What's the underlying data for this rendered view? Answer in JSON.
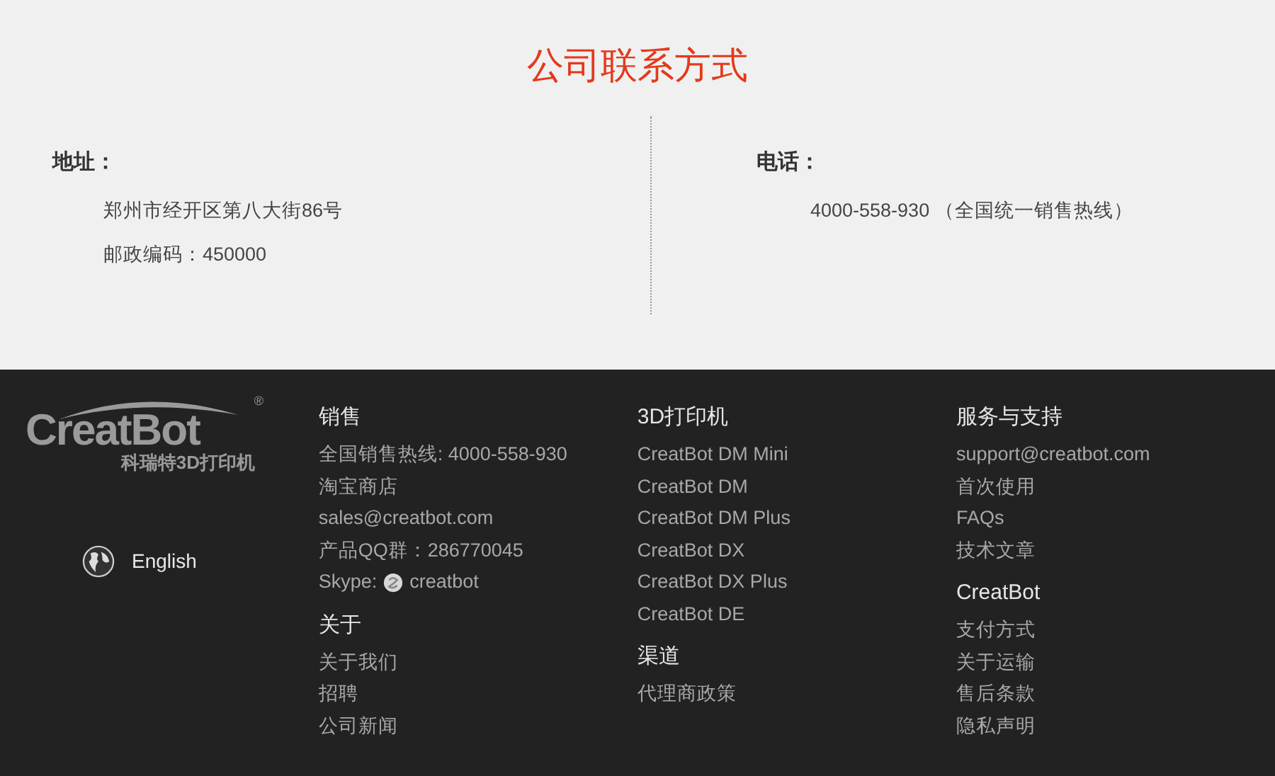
{
  "contact": {
    "title": "公司联系方式",
    "address": {
      "label": "地址：",
      "lines": [
        "郑州市经开区第八大街86号",
        "邮政编码：450000"
      ]
    },
    "phone": {
      "label": "电话：",
      "lines": [
        "4000-558-930 （全国统一销售热线）"
      ]
    }
  },
  "footer": {
    "logo": {
      "name": "CreatBot",
      "registered": "®",
      "tagline": "科瑞特3D打印机"
    },
    "language": "English",
    "columns": [
      {
        "sections": [
          {
            "title": "销售",
            "items": [
              {
                "kind": "text",
                "text": "全国销售热线: 4000-558-930"
              },
              {
                "kind": "text",
                "text": "淘宝商店"
              },
              {
                "kind": "text",
                "text": "sales@creatbot.com"
              },
              {
                "kind": "text",
                "text": "产品QQ群：286770045"
              },
              {
                "kind": "skype",
                "prefix": "Skype:",
                "text": "creatbot"
              }
            ]
          },
          {
            "title": "关于",
            "items": [
              {
                "kind": "text",
                "text": "关于我们"
              },
              {
                "kind": "text",
                "text": "招聘"
              },
              {
                "kind": "text",
                "text": "公司新闻"
              }
            ]
          }
        ]
      },
      {
        "sections": [
          {
            "title": "3D打印机",
            "items": [
              {
                "kind": "text",
                "text": "CreatBot DM Mini"
              },
              {
                "kind": "text",
                "text": "CreatBot DM"
              },
              {
                "kind": "text",
                "text": "CreatBot DM Plus"
              },
              {
                "kind": "text",
                "text": "CreatBot DX"
              },
              {
                "kind": "text",
                "text": "CreatBot DX Plus"
              },
              {
                "kind": "text",
                "text": "CreatBot DE"
              }
            ]
          },
          {
            "title": "渠道",
            "items": [
              {
                "kind": "text",
                "text": "代理商政策"
              }
            ]
          }
        ]
      },
      {
        "sections": [
          {
            "title": "服务与支持",
            "items": [
              {
                "kind": "text",
                "text": "support@creatbot.com"
              },
              {
                "kind": "text",
                "text": "首次使用"
              },
              {
                "kind": "text",
                "text": "FAQs"
              },
              {
                "kind": "text",
                "text": "技术文章"
              }
            ]
          },
          {
            "title": "CreatBot",
            "items": [
              {
                "kind": "text",
                "text": "支付方式"
              },
              {
                "kind": "text",
                "text": "关于运输"
              },
              {
                "kind": "text",
                "text": "售后条款"
              },
              {
                "kind": "text",
                "text": "隐私声明"
              }
            ]
          }
        ]
      }
    ]
  }
}
